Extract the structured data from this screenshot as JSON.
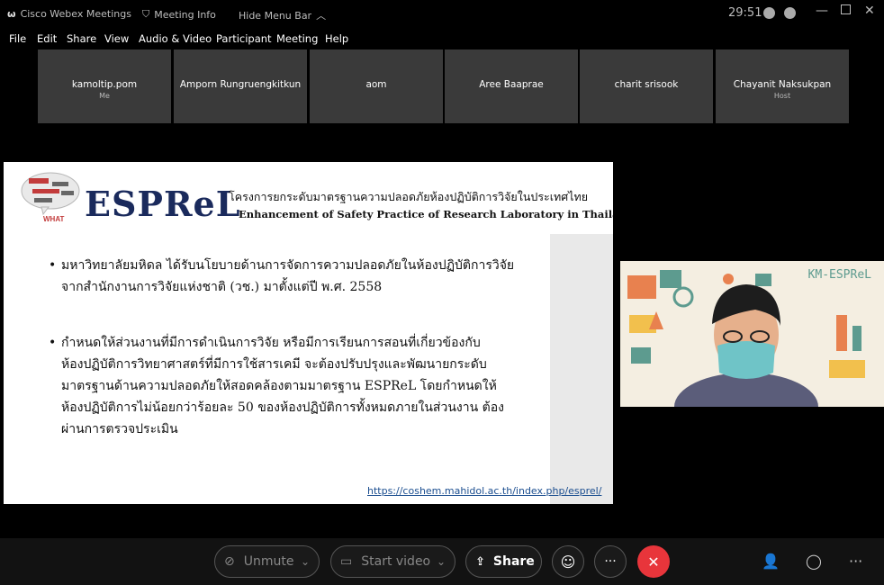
{
  "titlebar": {
    "app_name": "Cisco Webex Meetings",
    "meeting_info": "Meeting Info",
    "hide_menu": "Hide Menu Bar",
    "timer": "29:51"
  },
  "menu": [
    "File",
    "Edit",
    "Share",
    "View",
    "Audio & Video",
    "Participant",
    "Meeting",
    "Help"
  ],
  "participants": [
    {
      "name": "kamoltip.pom",
      "role": "Me"
    },
    {
      "name": "Amporn Rungruengkitkun",
      "role": ""
    },
    {
      "name": "aom",
      "role": ""
    },
    {
      "name": "Aree Baaprae",
      "role": ""
    },
    {
      "name": "charit srisook",
      "role": ""
    },
    {
      "name": "Chayanit Naksukpan",
      "role": "Host"
    }
  ],
  "slide": {
    "logo": "ESPReL",
    "header_th": "โครงการยกระดับมาตรฐานความปลอดภัยห้องปฏิบัติการวิจัยในประเทศไทย",
    "header_en": "Enhancement of Safety Practice of Research Laboratory in Thailand",
    "bullet1": [
      "มหาวิทยาลัยมหิดล ได้รับนโยบายด้านการจัดการความปลอดภัยในห้องปฏิบัติการวิจัย",
      "จากสำนักงานการวิจัยแห่งชาติ (วช.) มาตั้งแต่ปี พ.ศ. 2558"
    ],
    "bullet2": [
      "กำหนดให้ส่วนงานที่มีการดำเนินการวิจัย หรือมีการเรียนการสอนที่เกี่ยวข้องกับ",
      "ห้องปฏิบัติการวิทยาศาสตร์ที่มีการใช้สารเคมี จะต้องปรับปรุงและพัฒนายกระดับ",
      "มาตรฐานด้านความปลอดภัยให้สอดคล้องตามมาตรฐาน ESPReL โดยกำหนดให้",
      "ห้องปฏิบัติการไม่น้อยกว่าร้อยละ 50 ของห้องปฏิบัติการทั้งหมดภายในส่วนงาน ต้อง",
      "ผ่านการตรวจประเมิน"
    ],
    "link": "https://coshem.mahidol.ac.th/index.php/esprel/"
  },
  "video": {
    "overlay_text": "KM-ESPReL"
  },
  "controls": {
    "unmute": "Unmute",
    "start_video": "Start video",
    "share": "Share"
  },
  "colors": {
    "end_button": "#e8353b",
    "tile_bg": "#3a3a3a"
  }
}
